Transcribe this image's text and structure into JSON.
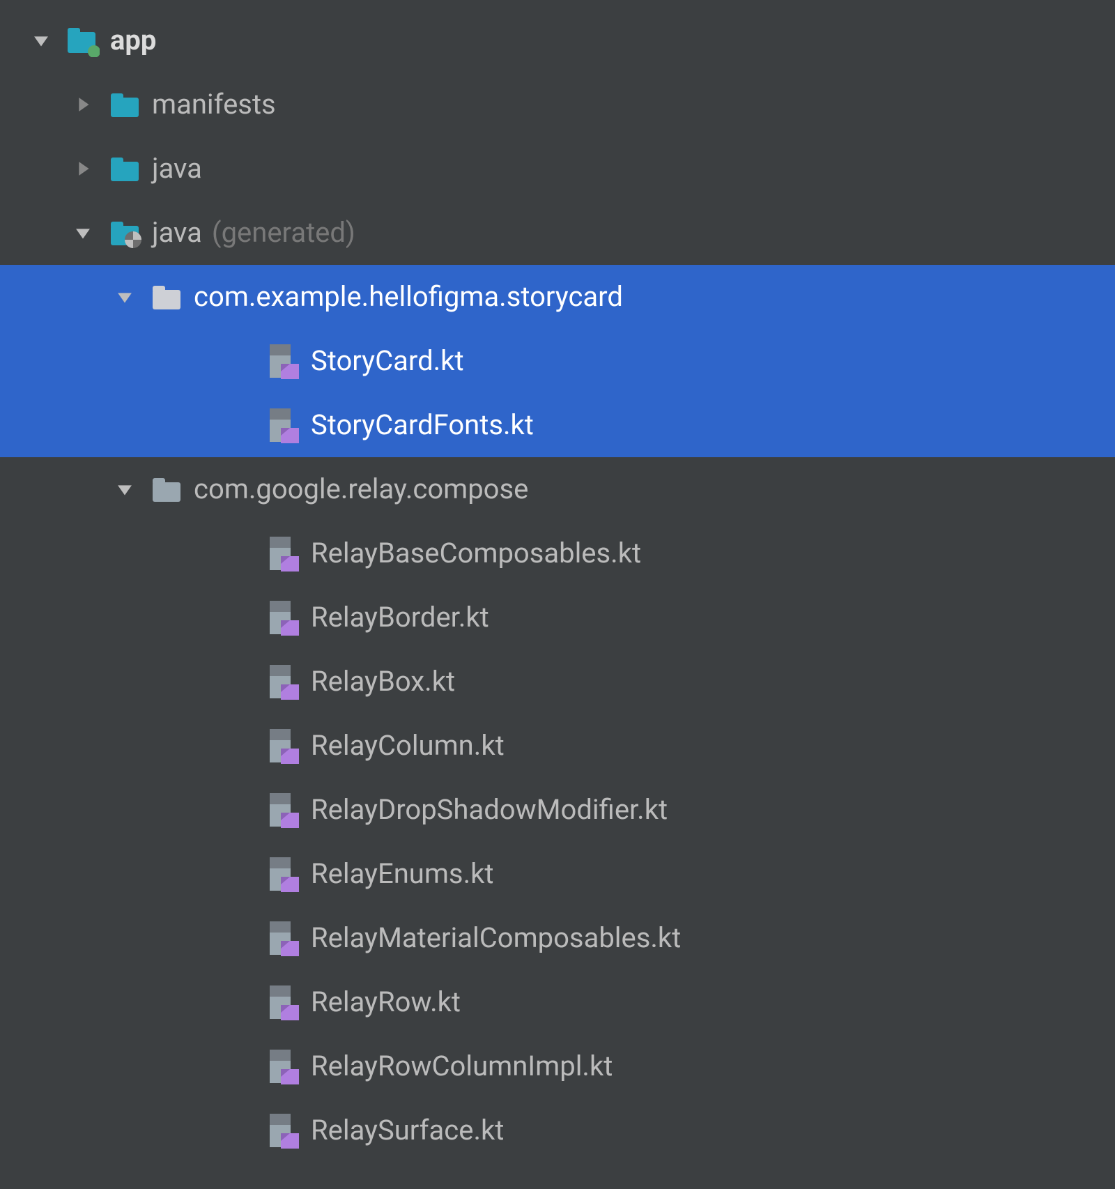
{
  "colors": {
    "background": "#3C3F41",
    "selection": "#2F65CA",
    "text": "#BBBBBB",
    "textBold": "#DCDCDC",
    "muted": "#787878",
    "folderTeal": "#26A4BE",
    "folderGray": "#9AA7B0",
    "moduleDot": "#59A869",
    "kotlinAccent": "#B07FE0"
  },
  "tree": [
    {
      "id": "app",
      "depth": 0,
      "arrow": "down",
      "icon": "module",
      "label": "app",
      "bold": true,
      "selected": false
    },
    {
      "id": "manifests",
      "depth": 1,
      "arrow": "right",
      "icon": "folder-teal",
      "label": "manifests",
      "selected": false
    },
    {
      "id": "java",
      "depth": 1,
      "arrow": "right",
      "icon": "folder-teal",
      "label": "java",
      "selected": false
    },
    {
      "id": "java-gen",
      "depth": 1,
      "arrow": "down",
      "icon": "folder-gen",
      "label": "java",
      "suffix": "(generated)",
      "selected": false
    },
    {
      "id": "pkg-storycard",
      "depth": 2,
      "arrow": "down",
      "icon": "folder-gray",
      "label": "com.example.hellofigma.storycard",
      "selected": true
    },
    {
      "id": "storycard-kt",
      "depth": 4,
      "arrow": "none",
      "icon": "kotlin",
      "label": "StoryCard.kt",
      "selected": true
    },
    {
      "id": "storycardfonts-kt",
      "depth": 4,
      "arrow": "none",
      "icon": "kotlin",
      "label": "StoryCardFonts.kt",
      "selected": true
    },
    {
      "id": "pkg-relay",
      "depth": 2,
      "arrow": "down",
      "icon": "folder-gray",
      "label": "com.google.relay.compose",
      "selected": false
    },
    {
      "id": "relay-base",
      "depth": 4,
      "arrow": "none",
      "icon": "kotlin",
      "label": "RelayBaseComposables.kt",
      "selected": false
    },
    {
      "id": "relay-border",
      "depth": 4,
      "arrow": "none",
      "icon": "kotlin",
      "label": "RelayBorder.kt",
      "selected": false
    },
    {
      "id": "relay-box",
      "depth": 4,
      "arrow": "none",
      "icon": "kotlin",
      "label": "RelayBox.kt",
      "selected": false
    },
    {
      "id": "relay-column",
      "depth": 4,
      "arrow": "none",
      "icon": "kotlin",
      "label": "RelayColumn.kt",
      "selected": false
    },
    {
      "id": "relay-dropshadow",
      "depth": 4,
      "arrow": "none",
      "icon": "kotlin",
      "label": "RelayDropShadowModifier.kt",
      "selected": false
    },
    {
      "id": "relay-enums",
      "depth": 4,
      "arrow": "none",
      "icon": "kotlin",
      "label": "RelayEnums.kt",
      "selected": false
    },
    {
      "id": "relay-material",
      "depth": 4,
      "arrow": "none",
      "icon": "kotlin",
      "label": "RelayMaterialComposables.kt",
      "selected": false
    },
    {
      "id": "relay-row",
      "depth": 4,
      "arrow": "none",
      "icon": "kotlin",
      "label": "RelayRow.kt",
      "selected": false
    },
    {
      "id": "relay-rowcol",
      "depth": 4,
      "arrow": "none",
      "icon": "kotlin",
      "label": "RelayRowColumnImpl.kt",
      "selected": false
    },
    {
      "id": "relay-surface",
      "depth": 4,
      "arrow": "none",
      "icon": "kotlin",
      "label": "RelaySurface.kt",
      "selected": false
    }
  ]
}
